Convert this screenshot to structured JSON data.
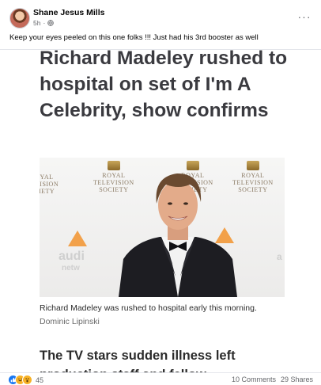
{
  "post": {
    "author": "Shane Jesus Mills",
    "time": "5h",
    "separator": "·",
    "more": "···",
    "caption": "Keep your eyes peeled on this one folks !!! Just had his 3rd booster as well"
  },
  "article": {
    "headline": "Richard Madeley rushed to hospital on set of I'm A Celebrity, show confirms",
    "image_caption": "Richard Madeley was rushed to hospital early this morning.",
    "photo_credit": "Dominic Lipinski",
    "subheading": "The TV stars sudden illness left production staff and fellow"
  },
  "backdrop": {
    "logo_lines": [
      "ROYAL",
      "TELEVISION",
      "SOCIETY"
    ],
    "logo_left_lines": [
      "YAL",
      "VISION",
      "IETY"
    ],
    "audi_text": "audi",
    "audi_sub": "netw"
  },
  "footer": {
    "reaction_count": "45",
    "comments": "10 Comments",
    "shares": "29 Shares"
  },
  "colors": {
    "like": "#1877f2",
    "haha": "#f7b125",
    "headline": "#3a3a3f"
  }
}
